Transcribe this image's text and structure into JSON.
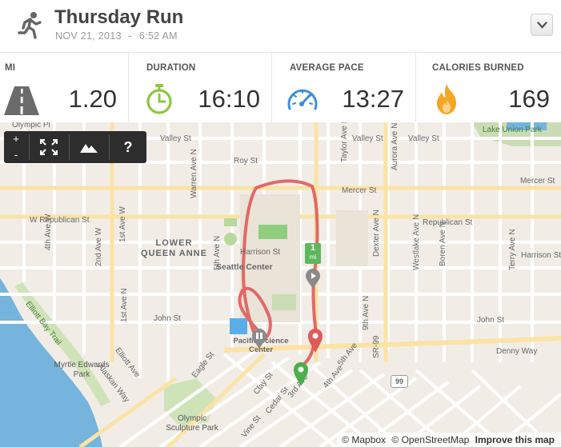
{
  "header": {
    "title": "Thursday Run",
    "date": "NOV 21, 2013",
    "separator": "-",
    "time": "6:52 AM"
  },
  "stats": [
    {
      "label": "MI",
      "value": "1.20",
      "icon": "road-icon"
    },
    {
      "label": "DURATION",
      "value": "16:10",
      "icon": "stopwatch-icon",
      "color": "#8dc63f"
    },
    {
      "label": "AVERAGE PACE",
      "value": "13:27",
      "icon": "speedometer-icon",
      "color": "#3a8fd9"
    },
    {
      "label": "CALORIES BURNED",
      "value": "169",
      "icon": "flame-icon",
      "color": "#f5a623"
    }
  ],
  "map": {
    "toolbar": {
      "zoom_in": "+",
      "zoom_out": "-",
      "help": "?"
    },
    "route_color": "#e05a5a",
    "mile_marker": {
      "number": "1",
      "unit": "mi"
    },
    "districts": {
      "lower_queen_anne_1": "LOWER",
      "lower_queen_anne_2": "QUEEN ANNE",
      "seattle_center": "Seattle Center",
      "pacific_science_center": "Pacific Science Center"
    },
    "labels": {
      "olympic_pl": "Olympic Pl",
      "valley_st_1": "Valley St",
      "valley_st_2": "Valley St",
      "valley_st_3": "Valley St",
      "roy_st": "Roy St",
      "mercer_st_1": "Mercer St",
      "mercer_st_2": "Mercer St",
      "w_republican_st": "W Republican St",
      "republican_st": "Republican St",
      "harrison_st_1": "Harrison St",
      "harrison_st_2": "Harrison St",
      "john_st_1": "John St",
      "john_st_2": "John St",
      "denny_way": "Denny Way",
      "lake_union_park": "Lake Union Park",
      "myrtle_edwards_park": "Myrtle Edwards Park",
      "olympic_sculpture_park": "Olympic Sculpture Park",
      "elliott_bay_trail": "Elliott Bay Trail",
      "alaskan_way": "Alaskan Way",
      "elliott_ave": "Elliott Ave",
      "warren_ave_n": "Warren Ave N",
      "taylor_ave_n": "Taylor Ave N",
      "dexter_ave_n": "Dexter Ave N",
      "aurora_ave_n": "Aurora Ave N",
      "westlake_ave_n": "Westlake Ave N",
      "terry_ave_n": "Terry Ave N",
      "boren_ave_n": "Boren Ave N",
      "fourth_ave_w": "4th Ave W",
      "second_ave_w": "2nd Ave W",
      "first_ave_w": "1st Ave W",
      "first_ave_n": "1st Ave N",
      "fifth_ave_n": "5th Ave N",
      "ninth_ave_n": "9th Ave N",
      "sr99": "SR-99",
      "cedar_st": "Cedar St",
      "vine_st": "Vine St",
      "clay_st": "Clay St",
      "eagle_st": "Eagle St",
      "third_ave": "3rd Ave",
      "fourth_ave": "4th Ave",
      "fifth_ave": "5th Ave",
      "highway_99": "99"
    },
    "attribution": {
      "mapbox": "© Mapbox",
      "osm": "© OpenStreetMap",
      "improve": "Improve this map"
    }
  }
}
